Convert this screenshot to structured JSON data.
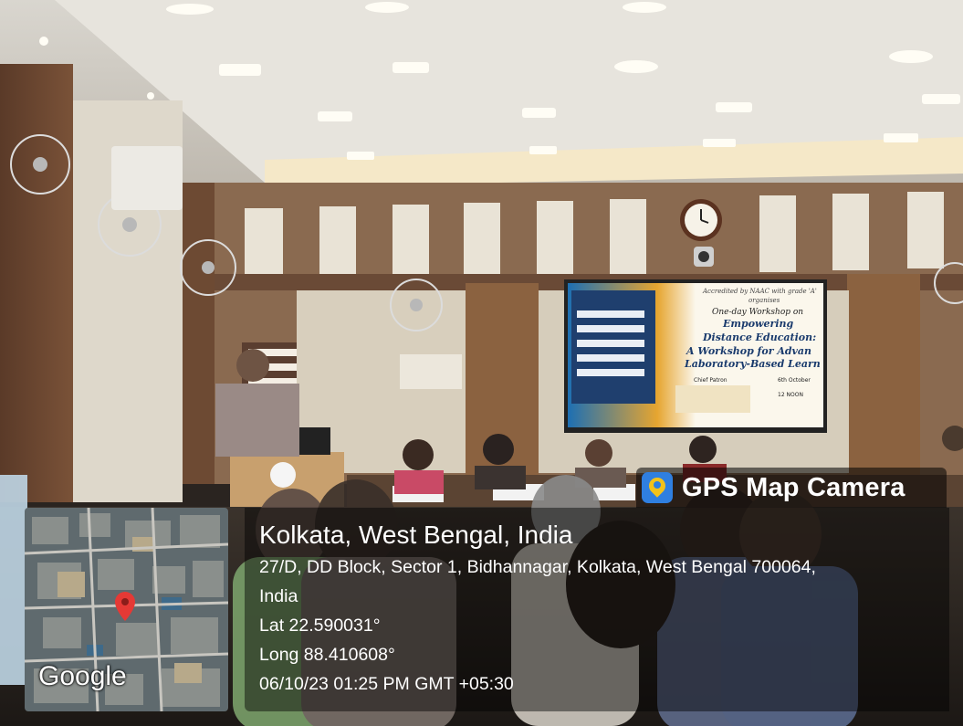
{
  "screen": {
    "slide": {
      "line1": "Accredited by NAAC with grade 'A'",
      "line2": "organises",
      "line3": "One-day Workshop on",
      "line4": "Empowering",
      "line5": "Distance Education:",
      "line6": "A Workshop for Advan",
      "line7": "Laboratory-Based Learn",
      "chief": "Chief Patron",
      "date": "6th October",
      "time": "12 NOON"
    }
  },
  "overlay": {
    "app_name": "GPS Map Camera",
    "place": "Kolkata, West Bengal, India",
    "address_line1": "27/D, DD Block, Sector 1, Bidhannagar, Kolkata, West Bengal 700064,",
    "address_line2": "India",
    "latitude": "Lat 22.590031°",
    "longitude": "Long 88.410608°",
    "datetime": "06/10/23 01:25 PM GMT +05:30",
    "map_label": "Google"
  },
  "colors": {
    "pin": "#e53935",
    "badge_icon": "#2f7fe0"
  }
}
